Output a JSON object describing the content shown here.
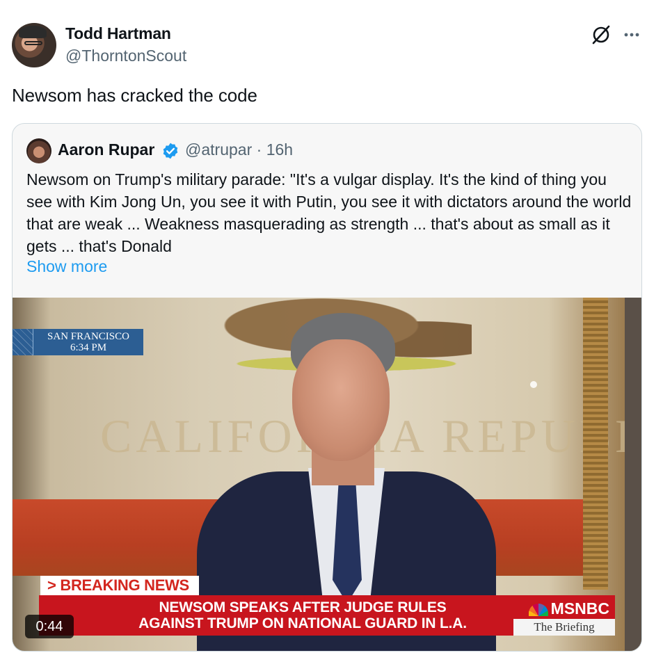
{
  "tweet": {
    "author_name": "Todd Hartman",
    "author_handle": "@ThorntonScout",
    "text": "Newsom has cracked the code"
  },
  "quoted_tweet": {
    "author_name": "Aaron Rupar",
    "author_handle": "@atrupar",
    "separator": " · ",
    "time": "16h",
    "body": "Newsom on Trump's military parade: \"It's a vulgar display. It's the kind of thing you see with Kim Jong Un, you see it with Putin, you see it with dictators around the world that are weak ... Weakness masquerading as strength ... that's about as small as it gets ... that's Donald",
    "show_more_label": "Show more"
  },
  "video": {
    "location_line1": "SAN FRANCISCO",
    "location_line2": "6:34 PM",
    "flag_words": "CALIFORNIA REPUBLIC",
    "breaking_label": "> BREAKING NEWS",
    "headline_line1": "NEWSOM SPEAKS AFTER JUDGE RULES",
    "headline_line2": "AGAINST TRUMP ON NATIONAL GUARD IN L.A.",
    "network": "MSNBC",
    "show_name": "The Briefing",
    "duration": "0:44"
  },
  "icons": {
    "grok": "grok-icon",
    "more": "more-icon",
    "verified": "verified-badge-icon"
  },
  "colors": {
    "link_blue": "#1d9bf0",
    "handle_gray": "#536471",
    "breaking_red": "#c8151e"
  }
}
